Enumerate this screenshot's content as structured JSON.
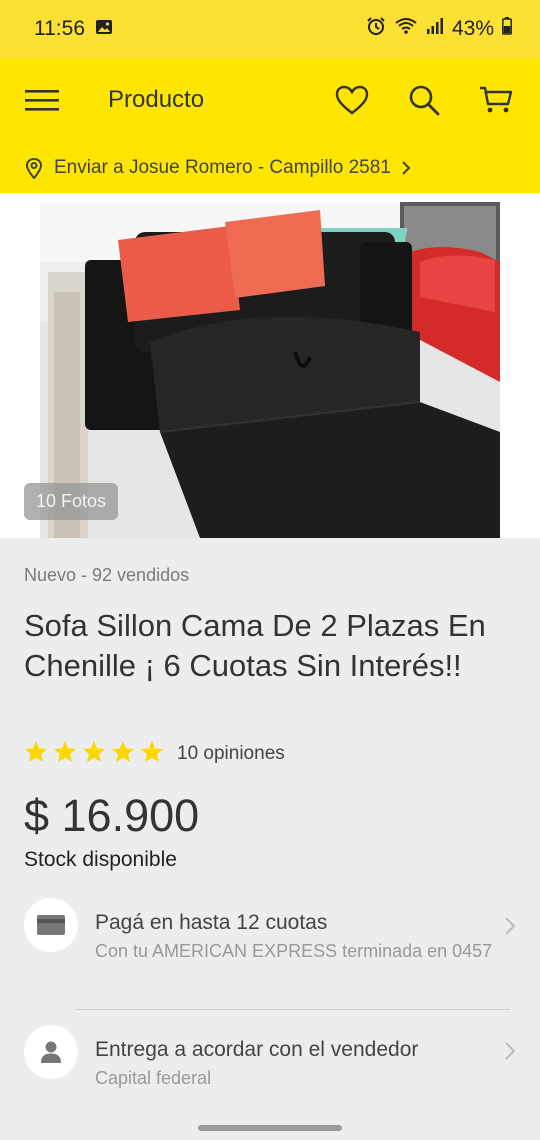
{
  "statusbar": {
    "time": "11:56",
    "battery": "43%"
  },
  "appbar": {
    "title": "Producto"
  },
  "shipping": {
    "text": "Enviar a Josue Romero - Campillo 2581"
  },
  "gallery": {
    "badge": "10 Fotos"
  },
  "product": {
    "condition": "Nuevo - 92 vendidos",
    "title": "Sofa Sillon Cama De 2 Plazas En Chenille ¡ 6 Cuotas Sin Interés!!",
    "stars": 5,
    "reviews": "10 opiniones",
    "price": "$ 16.900",
    "stock": "Stock disponible"
  },
  "payment": {
    "title": "Pagá en hasta 12 cuotas",
    "subtitle": "Con tu AMERICAN EXPRESS terminada en 0457"
  },
  "delivery": {
    "title": "Entrega a acordar con el vendedor",
    "subtitle": "Capital federal"
  },
  "colors": {
    "brand_yellow": "#fee600",
    "star": "#ffd600"
  }
}
